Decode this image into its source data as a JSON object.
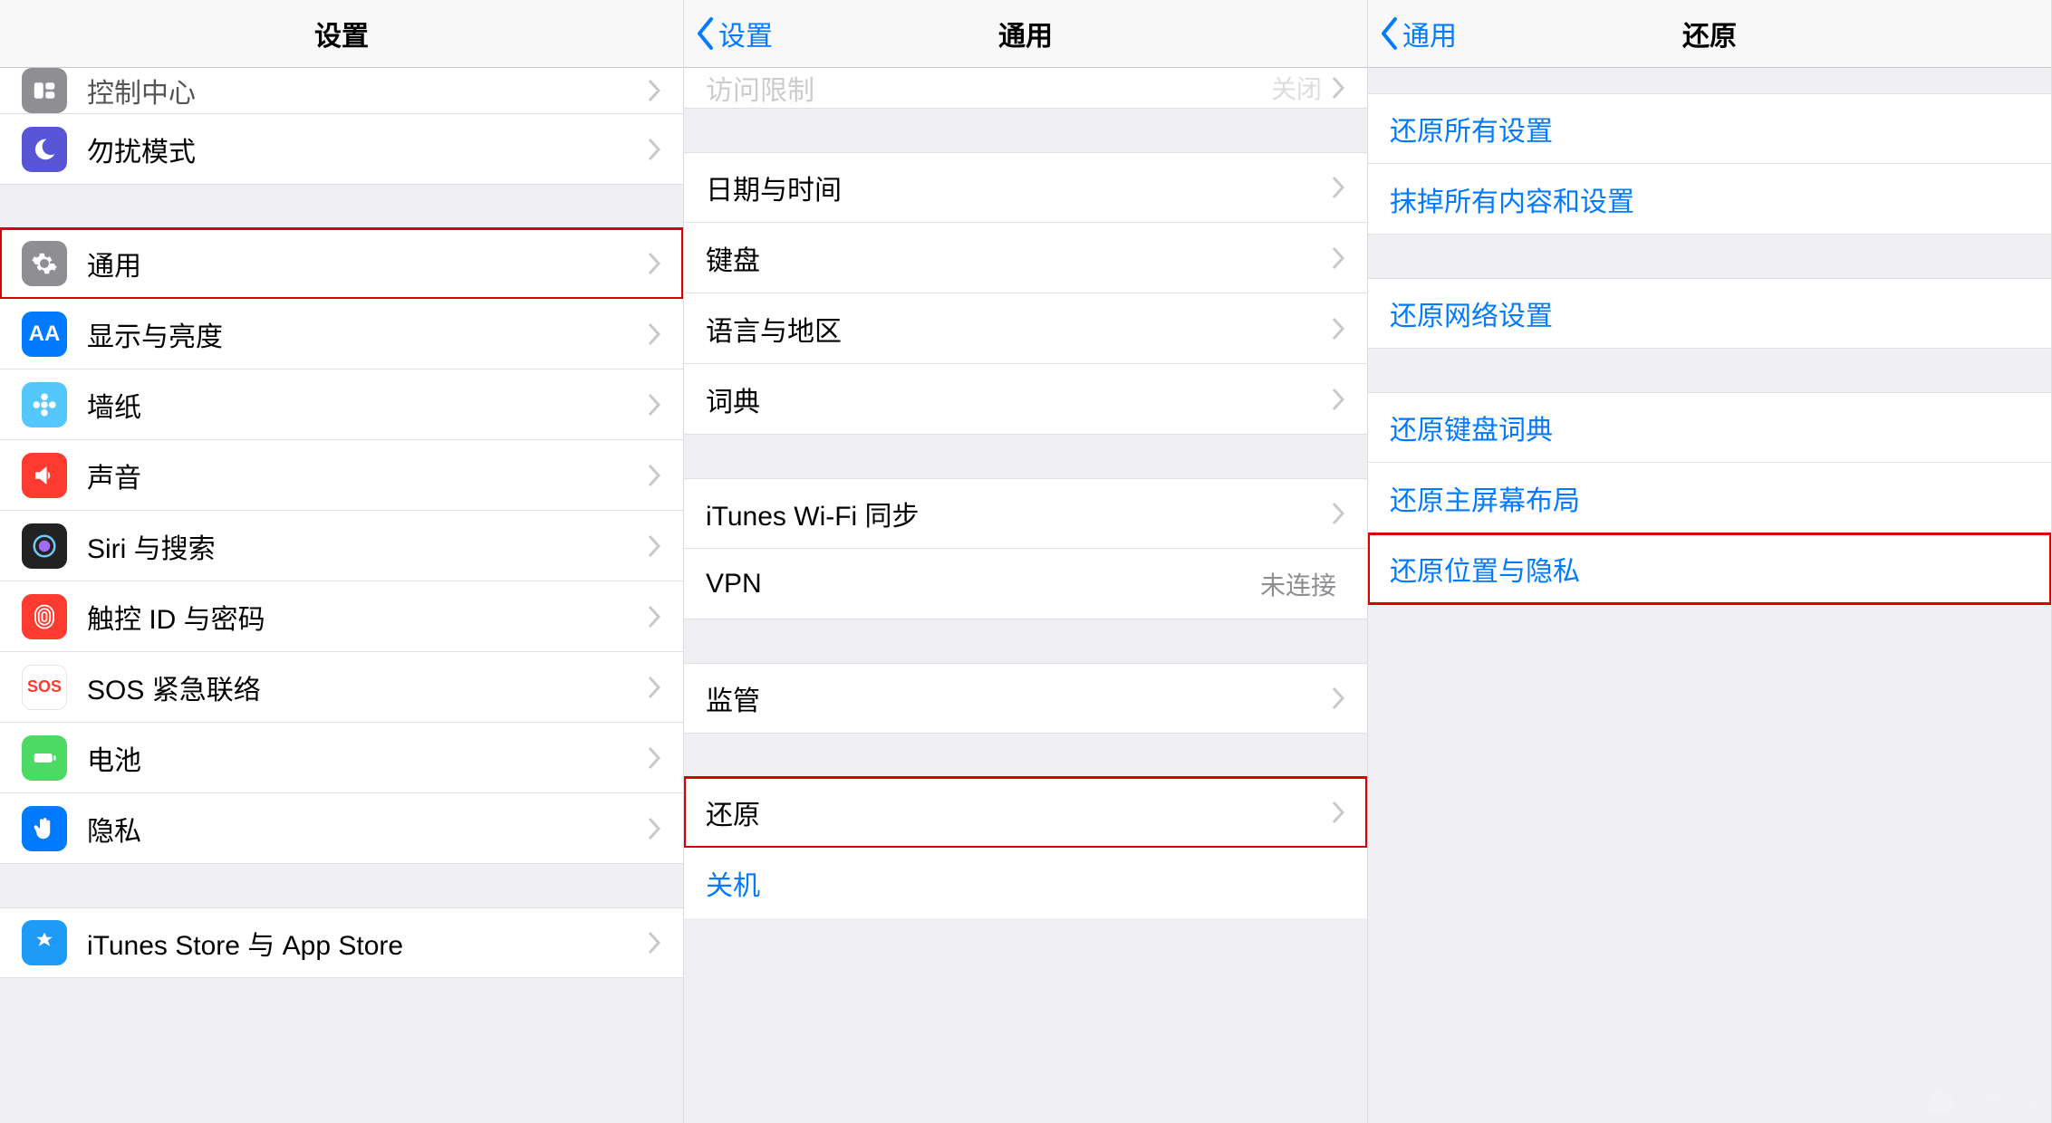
{
  "colors": {
    "accent": "#007aff",
    "highlight": "#d80000",
    "disabled": "#8e8e93",
    "bg": "#efeff4"
  },
  "panel1": {
    "title": "设置",
    "partial_row": "控制中心",
    "rows_a": [
      {
        "icon": "moon",
        "label": "勿扰模式"
      }
    ],
    "rows_b": [
      {
        "icon": "gear",
        "label": "通用",
        "highlight": true
      },
      {
        "icon": "aa",
        "label": "显示与亮度"
      },
      {
        "icon": "flower",
        "label": "墙纸"
      },
      {
        "icon": "speaker",
        "label": "声音"
      },
      {
        "icon": "siri",
        "label": "Siri 与搜索"
      },
      {
        "icon": "fingerprint",
        "label": "触控 ID 与密码"
      },
      {
        "icon": "sos",
        "label": "SOS 紧急联络"
      },
      {
        "icon": "battery",
        "label": "电池"
      },
      {
        "icon": "hand",
        "label": "隐私"
      }
    ],
    "rows_c": [
      {
        "icon": "appstore",
        "label": "iTunes Store 与 App Store"
      }
    ]
  },
  "panel2": {
    "back": "设置",
    "title": "通用",
    "partial_row": {
      "label": "访问限制",
      "value": "关闭"
    },
    "group_a": [
      {
        "label": "日期与时间"
      },
      {
        "label": "键盘"
      },
      {
        "label": "语言与地区"
      },
      {
        "label": "词典"
      }
    ],
    "group_b": [
      {
        "label": "iTunes Wi-Fi 同步"
      },
      {
        "label": "VPN",
        "value": "未连接",
        "no_chevron": true
      }
    ],
    "group_c": [
      {
        "label": "监管"
      }
    ],
    "group_d": [
      {
        "label": "还原",
        "highlight": true
      }
    ],
    "shutdown": "关机"
  },
  "panel3": {
    "back": "通用",
    "title": "还原",
    "group_a": [
      {
        "label": "还原所有设置"
      },
      {
        "label": "抹掉所有内容和设置"
      }
    ],
    "group_b": [
      {
        "label": "还原网络设置"
      }
    ],
    "group_c": [
      {
        "label": "还原键盘词典"
      },
      {
        "label": "还原主屏幕布局"
      },
      {
        "label": "还原位置与隐私",
        "highlight": true
      }
    ]
  },
  "watermark": "系统之家"
}
